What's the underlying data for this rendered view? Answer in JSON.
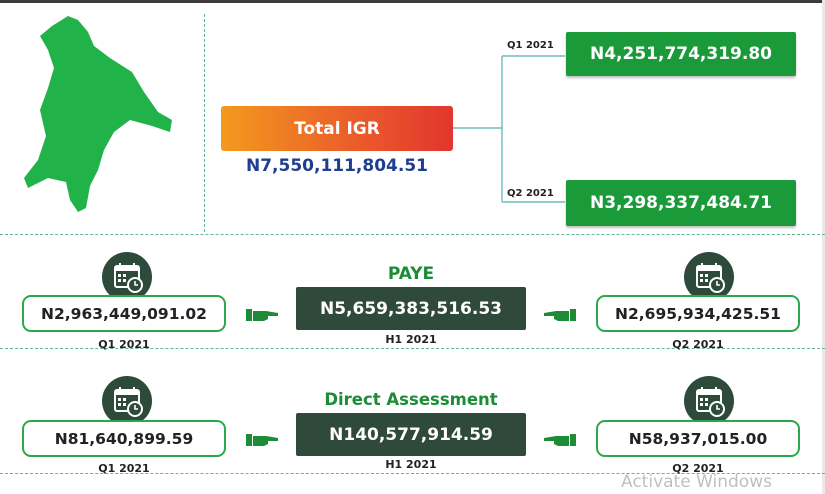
{
  "igr": {
    "title": "Total IGR",
    "total": "N7,550,111,804.51",
    "q1_label": "Q1 2021",
    "q1_value": "N4,251,774,319.80",
    "q2_label": "Q2 2021",
    "q2_value": "N3,298,337,484.71"
  },
  "paye": {
    "title": "PAYE",
    "h1_value": "N5,659,383,516.53",
    "h1_label": "H1 2021",
    "q1_value": "N2,963,449,091.02",
    "q1_label": "Q1 2021",
    "q2_value": "N2,695,934,425.51",
    "q2_label": "Q2 2021"
  },
  "direct": {
    "title": "Direct Assessment",
    "h1_value": "N140,577,914.59",
    "h1_label": "H1 2021",
    "q1_value": "N81,640,899.59",
    "q1_label": "Q1 2021",
    "q2_value": "N58,937,015.00",
    "q2_label": "Q2 2021"
  },
  "colors": {
    "green": "#1b9a3a",
    "dark_green": "#2f4a3a",
    "navy": "#1f3e8f",
    "orange": "#f39a1e",
    "red": "#e2362e"
  },
  "icons": [
    "state-map-icon",
    "calendar-clock-icon",
    "pointing-hand-icon"
  ],
  "watermark": "Activate Windows"
}
